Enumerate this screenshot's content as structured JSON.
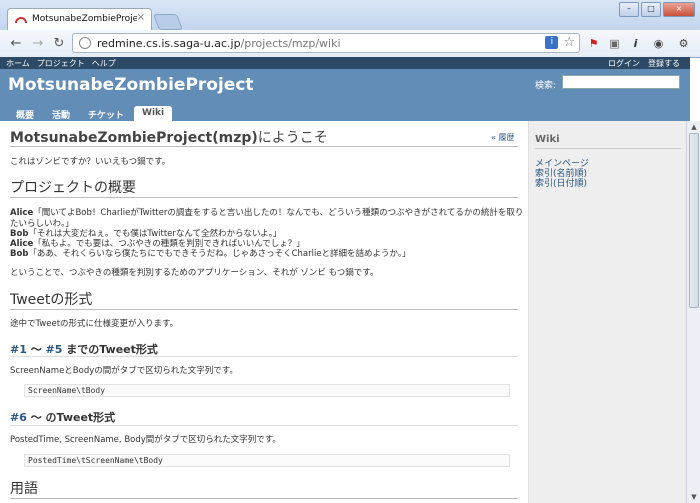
{
  "browser": {
    "tab_title": "MotsunabeZombieProjec",
    "close_glyph": "×",
    "window_buttons": [
      "–",
      "□",
      "×"
    ],
    "url_host": "redmine.cs.is.saga-u.ac.jp",
    "url_path": "/projects/mzp/wiki",
    "omni_badge": "i"
  },
  "topmenu": {
    "left": [
      "ホーム",
      "プロジェクト",
      "ヘルプ"
    ],
    "right": [
      "ログイン",
      "登録する"
    ]
  },
  "header": {
    "title": "MotsunabeZombieProject",
    "search_label": "検索:"
  },
  "mainmenu": [
    "概要",
    "活動",
    "チケット",
    "Wiki"
  ],
  "page": {
    "title_bold": "MotsunabeZombieProject(mzp)",
    "title_rest": "にようこそ",
    "history_link": "履歴",
    "intro": "これはゾンビですか？いいえもつ鍋です。",
    "overview_heading": "プロジェクトの概要",
    "dialog": [
      {
        "speaker": "Alice",
        "text": "「聞いてよBob！CharlieがTwitterの調査をすると言い出したの！なんでも、どういう種類のつぶやきがされてるかの統計を取り"
      },
      {
        "speaker": "",
        "text": "たいらしいわ。」"
      },
      {
        "speaker": "Bob",
        "text": "「それは大変だねぇ。でも僕はTwitterなんて全然わからないよ。」"
      },
      {
        "speaker": "Alice",
        "text": "「私もよ。でも要は、つぶやきの種類を判別できればいいんでしょ？」"
      },
      {
        "speaker": "Bob",
        "text": "「ああ、それくらいなら僕たちにでもできそうだね。じゃあさっそくCharlieと詳細を詰めようか。」"
      }
    ],
    "summary": "ということで、つぶやきの種類を判別するためのアプリケーション、それが ゾンビ もつ鍋です。",
    "tweet_heading": "Tweetの形式",
    "tweet_note": "途中でTweetの形式に仕様変更が入ります。",
    "sub1": {
      "link1": "#1",
      "mid": " 〜 ",
      "link2": "#5",
      "rest": " までのTweet形式"
    },
    "sub1_desc": "ScreenNameとBodyの間がタブで区切られた文字列です。",
    "sub1_code": "ScreenName\\tBody",
    "sub2": {
      "link1": "#6",
      "mid": " 〜 のTweet形式"
    },
    "sub2_desc": "PostedTime, ScreenName, Body間がタブで区切られた文字列です。",
    "sub2_code": "PostedTime\\tScreenName\\tBody",
    "glossary_heading": "用語"
  },
  "sidebar": {
    "heading": "Wiki",
    "links": [
      "メインページ",
      "索引(名前順)",
      "索引(日付順)"
    ]
  },
  "colors": {
    "header_bg": "#628db6",
    "topmenu_bg": "#2c4966",
    "link": "#2a5685"
  }
}
